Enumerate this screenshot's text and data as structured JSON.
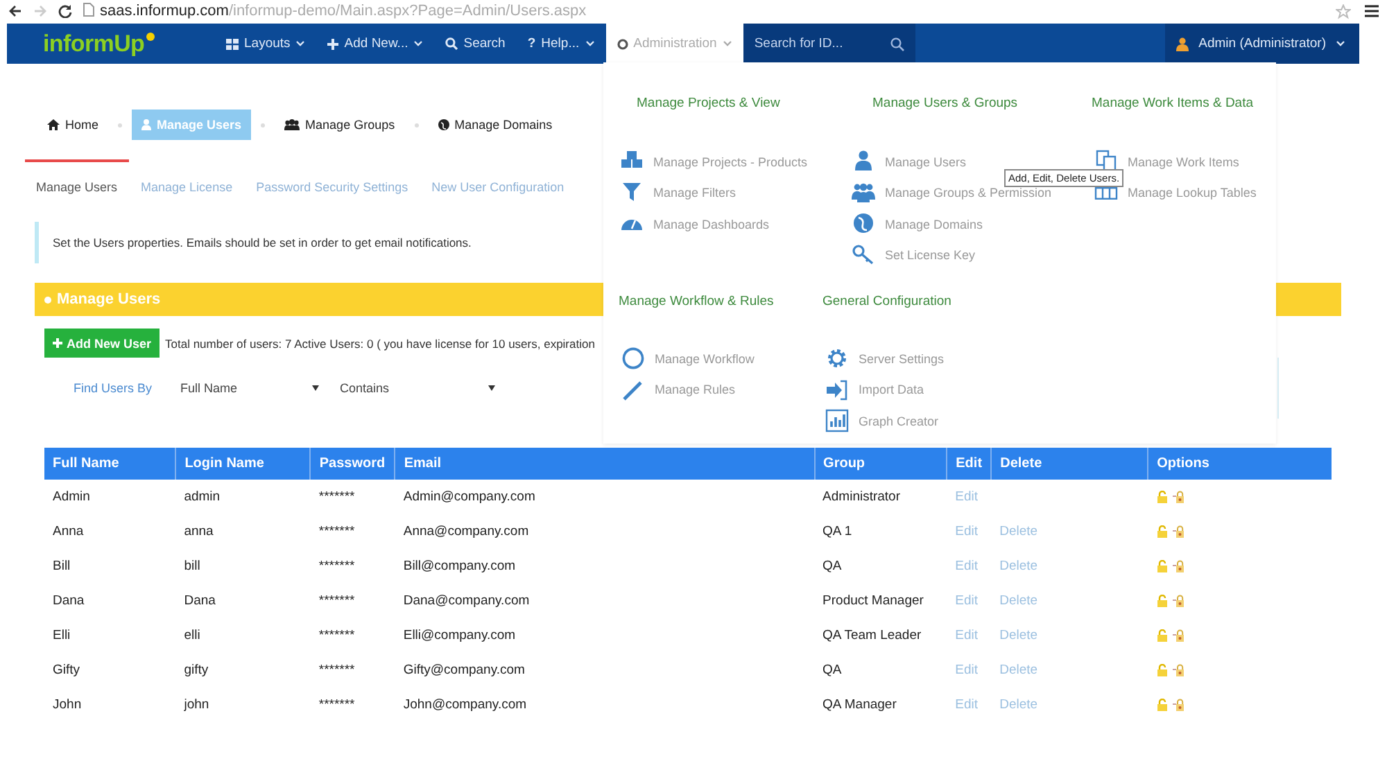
{
  "browser": {
    "host": "saas.informup.com",
    "path": "/informup-demo/Main.aspx?Page=Admin/Users.aspx"
  },
  "navbar": {
    "logo": "informUp",
    "items": [
      {
        "label": "Layouts",
        "caret": true,
        "selected": false
      },
      {
        "label": "Add New...",
        "caret": true,
        "selected": false
      },
      {
        "label": "Search",
        "caret": false,
        "selected": false
      },
      {
        "label": "Help...",
        "glyph": "?",
        "caret": true,
        "selected": false
      },
      {
        "label": "Administration",
        "caret": true,
        "selected": true
      }
    ],
    "search_placeholder": "Search for ID...",
    "user": "Admin (Administrator)"
  },
  "breadcrumb": [
    {
      "label": "Home",
      "selected": false
    },
    {
      "label": "Manage Users",
      "selected": true
    },
    {
      "label": "Manage Groups",
      "selected": false
    },
    {
      "label": "Manage Domains",
      "selected": false
    }
  ],
  "tabs": [
    {
      "label": "Manage Users",
      "selected": true
    },
    {
      "label": "Manage License",
      "selected": false
    },
    {
      "label": "Password Security Settings",
      "selected": false
    },
    {
      "label": "New User Configuration",
      "selected": false
    }
  ],
  "info": "Set the Users properties. Emails should be set in order to get email notifications.",
  "panel_title": "Manage Users",
  "add_button": "Add New User",
  "summary": "Total number of users: 7   Active Users: 0 ( you have license for 10 users, expiration",
  "filter": {
    "label": "Find Users By",
    "field": "Full Name",
    "operator": "Contains"
  },
  "admin_menu": {
    "rows": [
      [
        {
          "title": "Manage Projects & View",
          "items": [
            "Manage Projects - Products",
            "Manage Filters",
            "Manage Dashboards"
          ]
        },
        {
          "title": "Manage Users & Groups",
          "items": [
            "Manage Users",
            "Manage Groups & Permission",
            "Manage Domains",
            "Set License Key"
          ]
        },
        {
          "title": "Manage Work Items & Data",
          "items": [
            "Manage Work Items",
            "Manage Lookup Tables"
          ]
        }
      ],
      [
        {
          "title": "Manage Workflow & Rules",
          "items": [
            "Manage Workflow",
            "Manage Rules"
          ]
        },
        {
          "title": "General Configuration",
          "items": [
            "Server Settings",
            "Import Data",
            "Graph Creator"
          ]
        }
      ]
    ],
    "tooltip": "Add, Edit, Delete Users."
  },
  "table": {
    "columns": [
      "Full Name",
      "Login Name",
      "Password",
      "Email",
      "Group",
      "Edit",
      "Delete",
      "Options"
    ],
    "rows": [
      {
        "full_name": "Admin",
        "login": "admin",
        "password": "*******",
        "email": "Admin@company.com",
        "group": "Administrator",
        "edit": "Edit"
      },
      {
        "full_name": "Anna",
        "login": "anna",
        "password": "*******",
        "email": "Anna@company.com",
        "group": "QA 1",
        "edit": "Edit",
        "delete": "Delete"
      },
      {
        "full_name": "Bill",
        "login": "bill",
        "password": "*******",
        "email": "Bill@company.com",
        "group": "QA",
        "edit": "Edit",
        "delete": "Delete"
      },
      {
        "full_name": "Dana",
        "login": "Dana",
        "password": "*******",
        "email": "Dana@company.com",
        "group": "Product Manager",
        "edit": "Edit",
        "delete": "Delete"
      },
      {
        "full_name": "Elli",
        "login": "elli",
        "password": "*******",
        "email": "Elli@company.com",
        "group": "QA Team Leader",
        "edit": "Edit",
        "delete": "Delete"
      },
      {
        "full_name": "Gifty",
        "login": "gifty",
        "password": "*******",
        "email": "Gifty@company.com",
        "group": "QA",
        "edit": "Edit",
        "delete": "Delete"
      },
      {
        "full_name": "John",
        "login": "john",
        "password": "*******",
        "email": "John@company.com",
        "group": "QA Manager",
        "edit": "Edit",
        "delete": "Delete"
      }
    ]
  }
}
